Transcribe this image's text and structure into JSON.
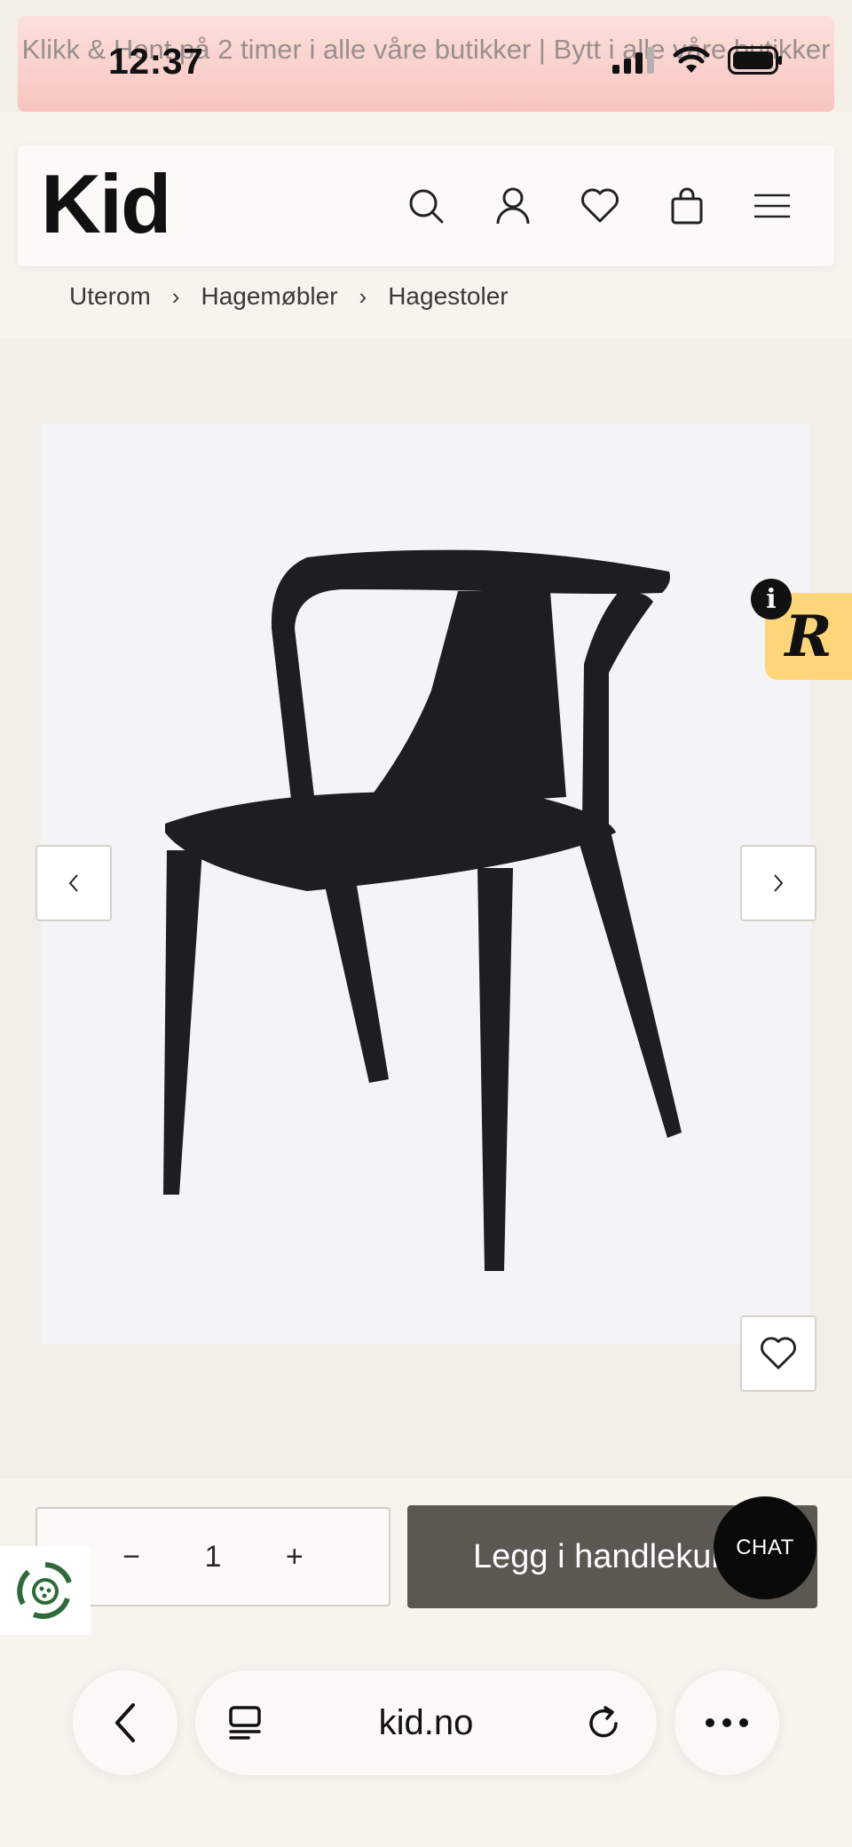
{
  "status_bar": {
    "time": "12:37"
  },
  "promo": {
    "text": "Klikk & Hent på 2 timer i alle våre butikker | Bytt i alle våre butikker"
  },
  "header": {
    "logo": "Kid",
    "icons": [
      "search-icon",
      "account-icon",
      "heart-icon",
      "bag-icon",
      "menu-icon"
    ]
  },
  "breadcrumb": {
    "items": [
      "Uterom",
      "Hagemøbler",
      "Hagestoler"
    ],
    "separator": "›"
  },
  "gallery": {
    "prev_label": "‹",
    "next_label": "›"
  },
  "badge": {
    "letter": "R",
    "info": "i",
    "color": "#fdd57a"
  },
  "purchase": {
    "qty_minus": "−",
    "qty_value": "1",
    "qty_plus": "+",
    "add_to_cart": "Legg i handlekurv",
    "button_color": "#5d5752"
  },
  "chat": {
    "label": "CHAT"
  },
  "browser": {
    "url": "kid.no"
  }
}
